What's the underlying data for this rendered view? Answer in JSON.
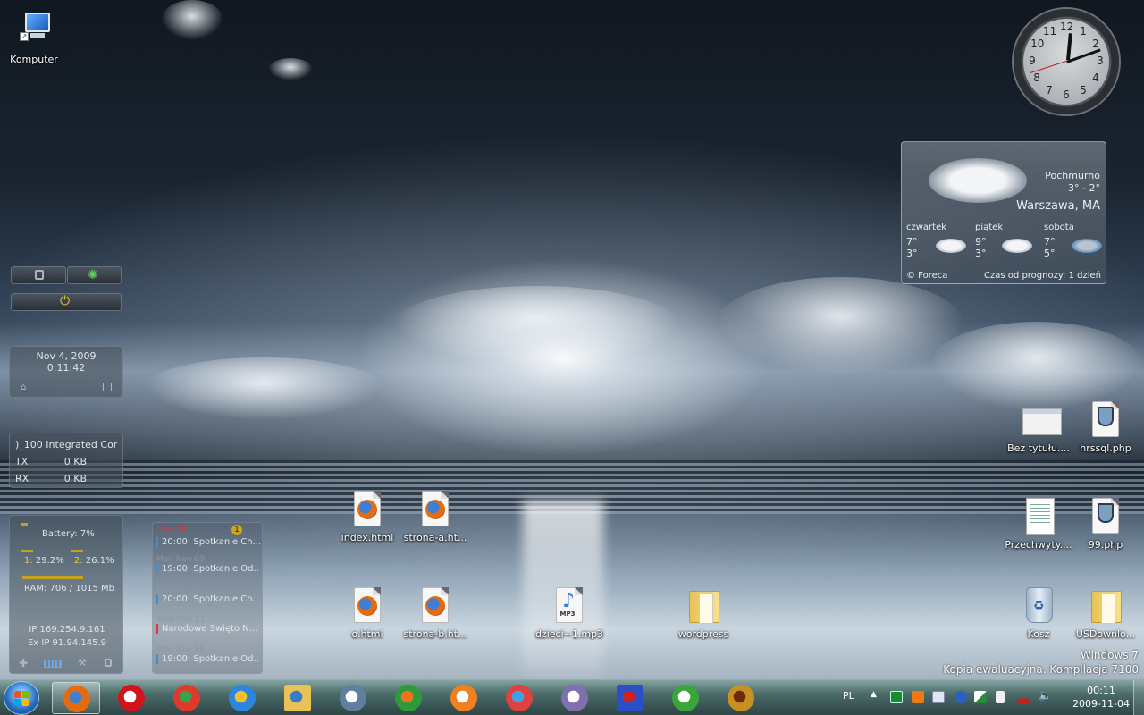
{
  "desktop": {
    "icons_top_left": [
      {
        "label": "Komputer",
        "icon": "computer-icon"
      }
    ],
    "icons_center": [
      {
        "label": "index.html",
        "icon": "firefox-html-icon"
      },
      {
        "label": "strona-a.ht...",
        "icon": "firefox-html-icon"
      },
      {
        "label": "o.html",
        "icon": "firefox-html-icon"
      },
      {
        "label": "strona-b.ht...",
        "icon": "firefox-html-icon"
      },
      {
        "label": "dzieci~1.mp3",
        "icon": "mp3-icon"
      },
      {
        "label": "wordpress",
        "icon": "folder-icon"
      }
    ],
    "icons_right": [
      {
        "label": "Bez tytułu....",
        "icon": "blank-window-icon"
      },
      {
        "label": "hrssql.php",
        "icon": "php-file-icon"
      },
      {
        "label": "Przechwyty....",
        "icon": "document-icon"
      },
      {
        "label": "99.php",
        "icon": "php-file-icon"
      },
      {
        "label": "Kosz",
        "icon": "recycle-bin-icon"
      },
      {
        "label": "USDownlo...",
        "icon": "folder-icon"
      }
    ],
    "mp3_badge": "MP3"
  },
  "gadgets": {
    "datetime": {
      "date": "Nov 4, 2009",
      "time": "0:11:42"
    },
    "network": {
      "adapter": ")_100 Integrated Con",
      "tx_label": "TX",
      "tx_value": "0 KB",
      "rx_label": "RX",
      "rx_value": "0 KB"
    },
    "system": {
      "battery": "Battery: 7%",
      "cpu1_label": "1:",
      "cpu1_value": "29.2%",
      "cpu2_label": "2:",
      "cpu2_value": "26.1%",
      "ram": "RAM: 706 / 1015 Mb",
      "ip": "IP 169.254.9.161",
      "ex_ip": "Ex IP 91.94.145.9"
    },
    "calendar": {
      "top_date": "Nov 04",
      "events": [
        {
          "header": "",
          "title": "20:00: Spotkanie Ch..."
        },
        {
          "header": "Mon Nov 09",
          "title": "19:00: Spotkanie Od..."
        },
        {
          "header": "Tue Nov 10",
          "title": "20:00: Spotkanie Ch..."
        },
        {
          "header": "Wed Nov 11",
          "title": "Narodowe Święto N..."
        },
        {
          "header": "Mon Nov 16",
          "title": "19:00: Spotkanie Od..."
        }
      ],
      "badge": "1"
    },
    "clock": {
      "numbers": [
        "1",
        "2",
        "3",
        "4",
        "5",
        "6",
        "7",
        "8",
        "9",
        "10",
        "11",
        "12"
      ],
      "hour": 12,
      "minute": 11,
      "second": 42
    },
    "weather": {
      "condition": "Pochmurno",
      "temp_range": "3° - 2°",
      "location": "Warszawa, MA",
      "forecast": [
        {
          "day": "czwartek",
          "high": "7°",
          "low": "3°"
        },
        {
          "day": "piątek",
          "high": "9°",
          "low": "3°"
        },
        {
          "day": "sobota",
          "high": "7°",
          "low": "5°"
        }
      ],
      "source": "© Foreca",
      "updated": "Czas od prognozy: 1 dzień"
    }
  },
  "watermark": {
    "line1": "Windows 7",
    "line2": "Kopia ewaluacyjna. Kompilacja 7100"
  },
  "taskbar": {
    "apps": [
      {
        "name": "firefox",
        "color": "#e36b12",
        "accent": "#3c7fd6",
        "active": true
      },
      {
        "name": "opera",
        "color": "#d1141b",
        "accent": "#ffffff",
        "active": false
      },
      {
        "name": "chrome",
        "color": "#dd3a2b",
        "accent": "#3aa14a",
        "active": false
      },
      {
        "name": "internet-explorer",
        "color": "#2c86e0",
        "accent": "#f0c030",
        "active": false
      },
      {
        "name": "explorer",
        "color": "#e8c257",
        "accent": "#3a7cc8",
        "active": false
      },
      {
        "name": "php-editor",
        "color": "#5f7f9f",
        "accent": "#ffffff",
        "active": false
      },
      {
        "name": "windows-update",
        "color": "#2f9a3a",
        "accent": "#f07020",
        "active": false
      },
      {
        "name": "media-player",
        "color": "#f08020",
        "accent": "#ffffff",
        "active": false
      },
      {
        "name": "picasa",
        "color": "#e04040",
        "accent": "#40a0e0",
        "active": false
      },
      {
        "name": "pidgin",
        "color": "#8070b0",
        "accent": "#ffffff",
        "active": false
      },
      {
        "name": "save-disk",
        "color": "#2a50c8",
        "accent": "#d02020",
        "active": false
      },
      {
        "name": "utorrent",
        "color": "#3aa63a",
        "accent": "#ffffff",
        "active": false
      },
      {
        "name": "dosbox",
        "color": "#c89020",
        "accent": "#6a2a10",
        "active": false
      }
    ],
    "tray": {
      "language": "PL",
      "time": "00:11",
      "date": "2009-11-04",
      "icons": [
        "show-hidden-icon",
        "network-monitor-icon",
        "orange-icon",
        "mail-icon",
        "bluetooth-icon",
        "security-icon",
        "power-icon",
        "signal-icon",
        "volume-icon"
      ]
    }
  }
}
